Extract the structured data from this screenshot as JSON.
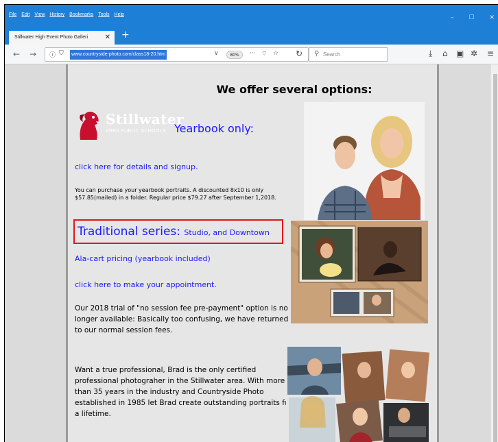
{
  "browser": {
    "menu": [
      "File",
      "Edit",
      "View",
      "History",
      "Bookmarks",
      "Tools",
      "Help"
    ],
    "window_controls": [
      "–",
      "☐",
      "✕"
    ],
    "tab_title": "Stillwater High Event Photo Galleri",
    "tab_close": "✕",
    "new_tab": "+",
    "url": "www.countryside-photo.com/class18-20.htm",
    "zoom": "80%",
    "search_placeholder": "Search"
  },
  "page": {
    "heading": "We offer several options:",
    "logo_text": "Stillwater",
    "logo_sub": "AREA PUBLIC SCHOOLS",
    "yearbook_title": "Yearbook only:",
    "yearbook_link": "click here for details and signup.",
    "yearbook_desc": "You can purchase your yearbook portraits. A discounted 8x10 is only $57.85(mailed) in a folder. Regular price $79.27 after September 1,2018.",
    "traditional_title": "Traditional series:",
    "traditional_sub": "Studio, and Downtown",
    "alacart_link": "Ala-cart pricing (yearbook included)",
    "appointment_link": "click here to make your appointment.",
    "trial_text": "Our 2018 trial of \"no session fee pre-payment\" option is no longer available: Basically too confusing, we have returned to our normal session fees.",
    "pro_text": "Want a true professional, Brad is the only certified professional photograher in the Stillwater area. With more than 35 years in the industry and Countryside Photo established in 1985 let Brad create outstanding portraits for a lifetime."
  },
  "colors": {
    "browser_blue": "#1d7fd6",
    "link_blue": "#1a1aff",
    "highlight_red": "#e01616",
    "logo_red": "#c8102e"
  }
}
